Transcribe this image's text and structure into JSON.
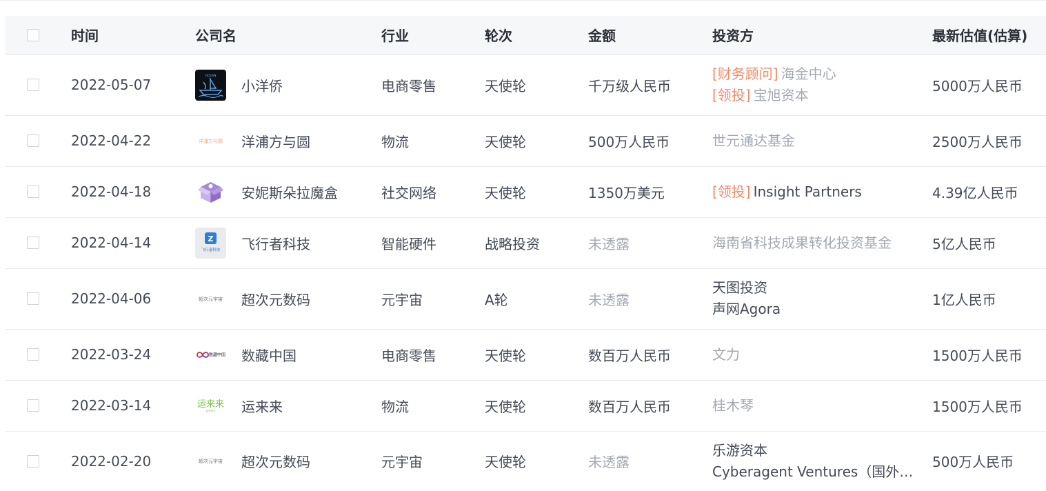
{
  "columns": {
    "time": "时间",
    "company": "公司名",
    "industry": "行业",
    "round": "轮次",
    "amount": "金额",
    "investors": "投资方",
    "valuation": "最新估值(估算)"
  },
  "rows": [
    {
      "date": "2022-05-07",
      "logo": "ocean-ship-logo",
      "company": "小洋侨",
      "industry": "电商零售",
      "round": "天使轮",
      "amount": "千万级人民币",
      "amount_disclosed": true,
      "investors": [
        {
          "tag": "[财务顾问]",
          "name": "海金中心"
        },
        {
          "tag": "[领投]",
          "name": "宝旭资本"
        }
      ],
      "valuation": "5000万人民币"
    },
    {
      "date": "2022-04-22",
      "logo": "text-logo",
      "logo_text": "洋浦方与圆",
      "company": "洋浦方与圆",
      "industry": "物流",
      "round": "天使轮",
      "amount": "500万人民币",
      "amount_disclosed": true,
      "investors": [
        {
          "tag": "",
          "name": "世元通达基金"
        }
      ],
      "valuation": "2500万人民币"
    },
    {
      "date": "2022-04-18",
      "logo": "purple-box-logo",
      "company": "安妮斯朵拉魔盒",
      "industry": "社交网络",
      "round": "天使轮",
      "amount": "1350万美元",
      "amount_disclosed": true,
      "investors": [
        {
          "tag": "[领投]",
          "name": "Insight Partners"
        }
      ],
      "valuation": "4.39亿人民币"
    },
    {
      "date": "2022-04-14",
      "logo": "flyer-logo",
      "logo_text": "飞行者科技",
      "company": "飞行者科技",
      "industry": "智能硬件",
      "round": "战略投资",
      "amount": "未透露",
      "amount_disclosed": false,
      "investors": [
        {
          "tag": "",
          "name": "海南省科技成果转化投资基金"
        }
      ],
      "valuation": "5亿人民币"
    },
    {
      "date": "2022-04-06",
      "logo": "text-logo",
      "logo_text": "超次元宇宙",
      "company": "超次元数码",
      "industry": "元宇宙",
      "round": "A轮",
      "amount": "未透露",
      "amount_disclosed": false,
      "investors": [
        {
          "tag": "",
          "name": "天图投资"
        },
        {
          "tag": "",
          "name": "声网Agora"
        }
      ],
      "valuation": "1亿人民币"
    },
    {
      "date": "2022-03-24",
      "logo": "infinity-logo",
      "logo_text": "数藏中国",
      "company": "数藏中国",
      "industry": "电商零售",
      "round": "天使轮",
      "amount": "数百万人民币",
      "amount_disclosed": true,
      "investors": [
        {
          "tag": "",
          "name": "文力"
        }
      ],
      "valuation": "1500万人民币"
    },
    {
      "date": "2022-03-14",
      "logo": "green-text-logo",
      "company": "运来来",
      "industry": "物流",
      "round": "天使轮",
      "amount": "数百万人民币",
      "amount_disclosed": true,
      "investors": [
        {
          "tag": "",
          "name": "桂木琴"
        }
      ],
      "valuation": "1500万人民币"
    },
    {
      "date": "2022-02-20",
      "logo": "text-logo",
      "logo_text": "超次元宇宙",
      "company": "超次元数码",
      "industry": "元宇宙",
      "round": "天使轮",
      "amount": "未透露",
      "amount_disclosed": false,
      "investors": [
        {
          "tag": "",
          "name": "乐游资本"
        },
        {
          "tag": "",
          "name": "Cyberagent Ventures（国外投..."
        }
      ],
      "valuation": "500万人民币"
    }
  ],
  "colors": {
    "tag": "#ef8a69",
    "muted": "#a3a9b2",
    "text": "#444b57",
    "header_bg": "#f6f7f9"
  }
}
